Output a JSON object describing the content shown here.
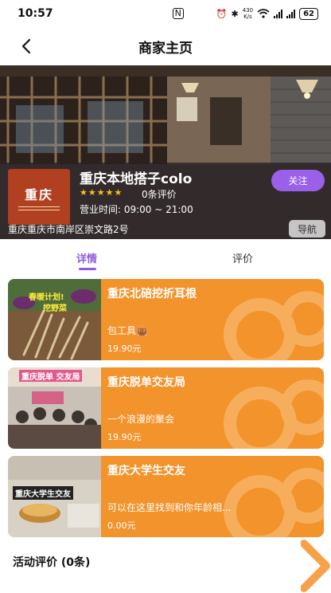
{
  "status_bar": {
    "time": "10:57",
    "nfc": "N",
    "net_speed_value": "430",
    "net_speed_unit": "K/s",
    "battery": "62"
  },
  "nav": {
    "title": "商家主页"
  },
  "store": {
    "logo_text": "重庆",
    "name": "重庆本地搭子colo",
    "rating_stars": 5,
    "rating_display": "★★★★★",
    "review_count": "0条评价",
    "hours": "营业时间: 09:00 ~ 21:00",
    "address": "重庆重庆市南岸区崇文路2号",
    "follow_label": "关注",
    "navigate_label": "导航"
  },
  "tabs": [
    {
      "label": "详情",
      "active": true
    },
    {
      "label": "评价",
      "active": false
    }
  ],
  "products": [
    {
      "title": "重庆北碚挖折耳根",
      "description": "包工具👜",
      "price": "19.90元",
      "image_labels": [
        "春暖计划!",
        "挖野菜"
      ]
    },
    {
      "title": "重庆脱单交友局",
      "description": "一个浪漫的聚会",
      "price": "19.90元",
      "image_labels": [
        "重庆脱单 交友局"
      ]
    },
    {
      "title": "重庆大学生交友",
      "description": "可以在这里找到和你年龄相...",
      "price": "0.00元",
      "image_labels": [
        "重庆大学生交友"
      ]
    }
  ],
  "reviews_section": {
    "title": "活动评价 (0条)"
  },
  "colors": {
    "accent_purple": "#9a60e8",
    "card_orange": "#f2932c",
    "star_yellow": "#f7c21d",
    "logo_red": "#b0401f"
  }
}
